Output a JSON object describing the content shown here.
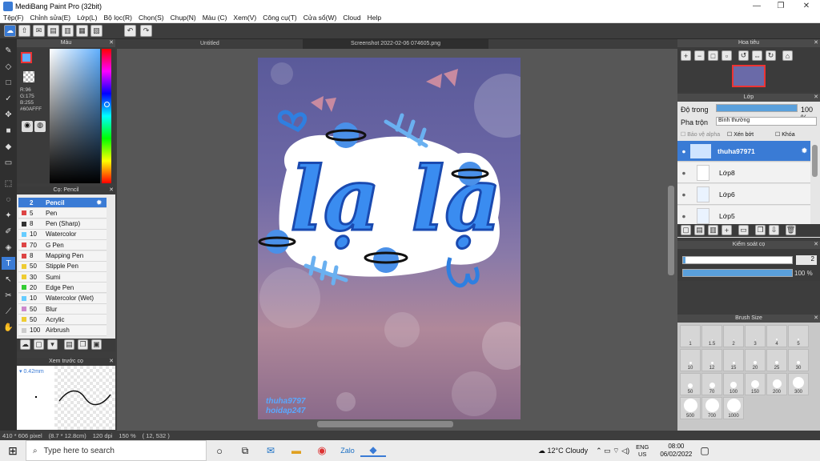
{
  "window": {
    "title": "MediBang Paint Pro (32bit)"
  },
  "menu": [
    "Tệp(F)",
    "Chỉnh sửa(E)",
    "Lớp(L)",
    "Bộ lọc(R)",
    "Chọn(S)",
    "Chụp(N)",
    "Màu (C)",
    "Xem(V)",
    "Công cụ(T)",
    "Cửa sổ(W)",
    "Cloud",
    "Help"
  ],
  "documents": {
    "tab1": "Untitled",
    "tab2": "Screenshot 2022-02-06 074605.png"
  },
  "color_panel": {
    "title": "Màu",
    "r": "R:96",
    "g": "G:175",
    "b": "B:255",
    "hex": "#60AFFF",
    "accent": "#60afff"
  },
  "brush_panel": {
    "title": "Cọ: Pencil",
    "items": [
      {
        "size": "2",
        "name": "Pencil",
        "color": "#3a7bd5"
      },
      {
        "size": "5",
        "name": "Pen",
        "color": "#d44"
      },
      {
        "size": "8",
        "name": "Pen (Sharp)",
        "color": "#333"
      },
      {
        "size": "10",
        "name": "Watercolor",
        "color": "#6cf"
      },
      {
        "size": "70",
        "name": "G Pen",
        "color": "#d44"
      },
      {
        "size": "8",
        "name": "Mapping Pen",
        "color": "#d44"
      },
      {
        "size": "50",
        "name": "Stipple Pen",
        "color": "#ec3"
      },
      {
        "size": "30",
        "name": "Sumi",
        "color": "#ec3"
      },
      {
        "size": "20",
        "name": "Edge Pen",
        "color": "#3c3"
      },
      {
        "size": "10",
        "name": "Watercolor (Wet)",
        "color": "#6cf"
      },
      {
        "size": "50",
        "name": "Blur",
        "color": "#c8c"
      },
      {
        "size": "50",
        "name": "Acrylic",
        "color": "#ec3"
      },
      {
        "size": "100",
        "name": "Airbrush",
        "color": "#ccc"
      }
    ]
  },
  "preview_panel": {
    "title": "Xem trước cọ",
    "size": "0.42mm"
  },
  "navigator": {
    "title": "Hoa tiêu"
  },
  "layers_panel": {
    "title": "Lớp",
    "opacity_label": "Độ trong",
    "opacity_value": "100 %",
    "opacity": 1.0,
    "blend_label": "Pha trộn",
    "blend_value": "Bình thường",
    "protect_alpha": "Bảo vệ alpha",
    "clipping": "Xén bớt",
    "lock": "Khóa",
    "layers": [
      "thuha97971",
      "Lớp8",
      "Lớp6",
      "Lớp5"
    ]
  },
  "brush_control": {
    "title": "Kiểm soát cọ",
    "size_value": "2",
    "opacity_value": "100 %",
    "opacity": 1.0
  },
  "brush_size": {
    "title": "Brush Size",
    "sizes": [
      "1",
      "1.5",
      "2",
      "3",
      "4",
      "5",
      "10",
      "12",
      "15",
      "20",
      "25",
      "30",
      "50",
      "70",
      "100",
      "150",
      "200",
      "300",
      "500",
      "700",
      "1000"
    ]
  },
  "artwork": {
    "text": "lạ lạ",
    "watermark1": "thuha9797",
    "watermark2": "hoidap247"
  },
  "status": {
    "pixels": "410 * 606 pixel",
    "size": "(8.7 * 12.8cm)",
    "dpi": "120 dpi",
    "zoom": "150 %",
    "coords": "( 12, 532 )"
  },
  "taskbar": {
    "search": "Type here to search",
    "weather": "12°C Cloudy",
    "lang": "ENG",
    "region": "US",
    "time": "08:00",
    "date": "06/02/2022"
  }
}
